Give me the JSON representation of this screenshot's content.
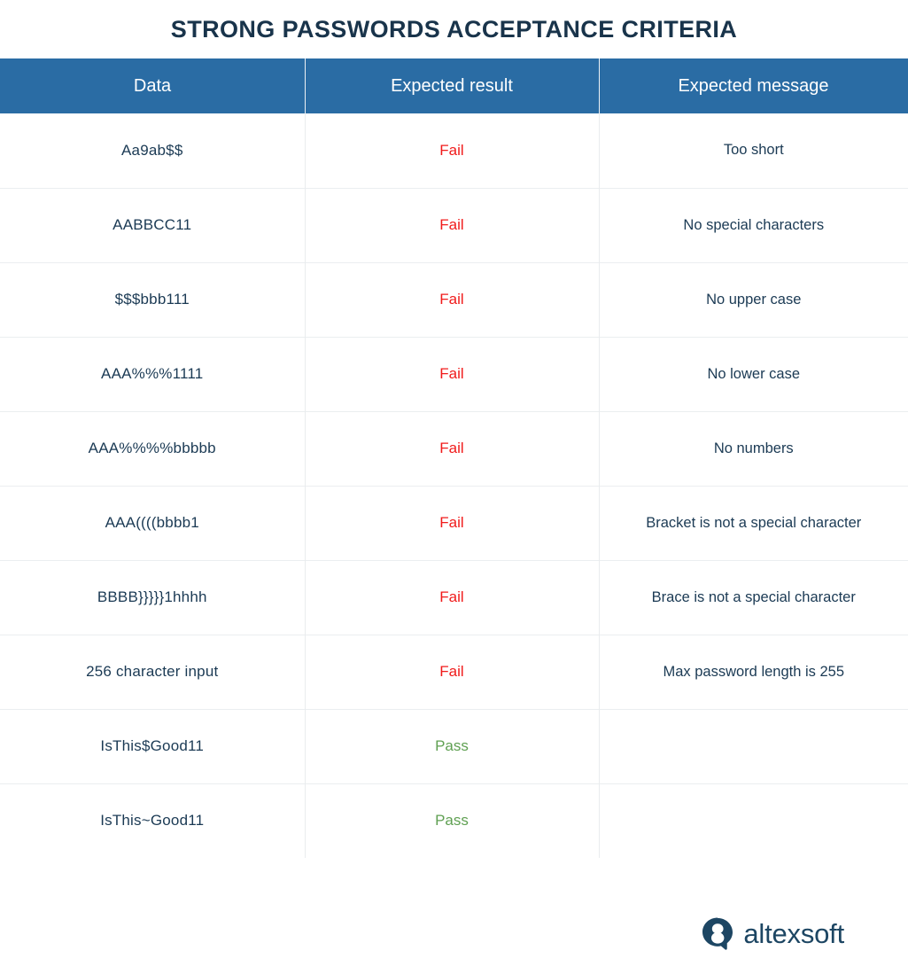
{
  "page": {
    "title": "STRONG PASSWORDS ACCEPTANCE CRITERIA",
    "accent_header_bg": "#2a6ca4",
    "text_color": "#1b3a54",
    "fail_color": "#f01b1b",
    "pass_color": "#5fa052",
    "row_divider_color": "#ebeef0"
  },
  "table": {
    "columns": [
      {
        "key": "data",
        "label": "Data"
      },
      {
        "key": "result",
        "label": "Expected result"
      },
      {
        "key": "message",
        "label": "Expected message"
      }
    ],
    "rows": [
      {
        "data": "Aa9ab$$",
        "result": "Fail",
        "message": "Too short"
      },
      {
        "data": "AABBCC11",
        "result": "Fail",
        "message": "No special characters"
      },
      {
        "data": "$$$bbb111",
        "result": "Fail",
        "message": "No upper case"
      },
      {
        "data": "AAA%%%1111",
        "result": "Fail",
        "message": "No lower case"
      },
      {
        "data": "AAA%%%%bbbbb",
        "result": "Fail",
        "message": "No numbers"
      },
      {
        "data": "AAA((((bbbb1",
        "result": "Fail",
        "message": "Bracket is not a special character"
      },
      {
        "data": "BBBB}}}}}1hhhh",
        "result": "Fail",
        "message": "Brace is not a special character"
      },
      {
        "data": "256 character input",
        "result": "Fail",
        "message": "Max password length is 255"
      },
      {
        "data": "IsThis$Good11",
        "result": "Pass",
        "message": ""
      },
      {
        "data": "IsThis~Good11",
        "result": "Pass",
        "message": ""
      }
    ]
  },
  "footer": {
    "logo_icon": "altexsoft-speech-bubble-icon",
    "brand": "altexsoft"
  }
}
